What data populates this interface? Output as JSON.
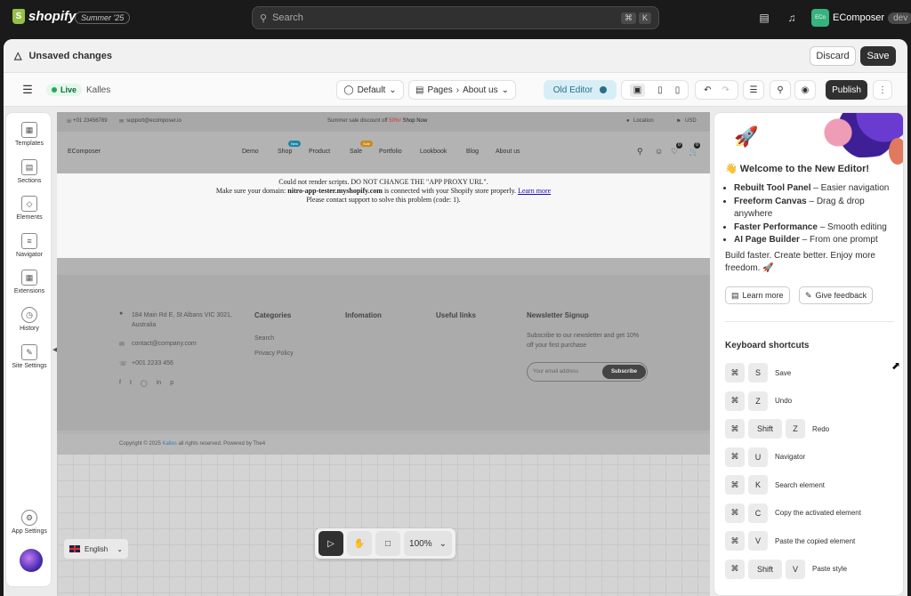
{
  "topbar": {
    "logo": "shopify",
    "season": "Summer '25",
    "search_placeholder": "Search",
    "kbd1": "⌘",
    "kbd2": "K",
    "account_name": "EComposer",
    "account_avatar": "ECo",
    "account_badge": "dev"
  },
  "unsaved": {
    "title": "Unsaved changes",
    "discard": "Discard",
    "save": "Save"
  },
  "toolbar": {
    "status": "Live",
    "theme": "Kalles",
    "template": "Default",
    "pages_label": "Pages",
    "page": "About us",
    "old_editor": "Old Editor",
    "publish": "Publish"
  },
  "leftbar": [
    {
      "label": "Templates",
      "icon": "templates-icon"
    },
    {
      "label": "Sections",
      "icon": "sections-icon"
    },
    {
      "label": "Elements",
      "icon": "elements-icon"
    },
    {
      "label": "Navigator",
      "icon": "navigator-icon"
    },
    {
      "label": "Extensions",
      "icon": "extensions-icon"
    },
    {
      "label": "History",
      "icon": "history-icon"
    },
    {
      "label": "Site Settings",
      "icon": "site-settings-icon"
    }
  ],
  "app_settings": "App Settings",
  "site": {
    "phone": "+01 23456789",
    "email": "support@ecomposer.io",
    "announce_prefix": "Summer sale discount off",
    "announce_pct": "50%!",
    "announce_link": "Shop Now",
    "location": "Location",
    "currency": "USD",
    "brand": "EComposer",
    "nav": [
      {
        "label": "Demo",
        "badge": ""
      },
      {
        "label": "Shop",
        "badge": "New"
      },
      {
        "label": "Product",
        "badge": ""
      },
      {
        "label": "Sale",
        "badge": "Sale"
      },
      {
        "label": "Portfolio",
        "badge": ""
      },
      {
        "label": "Lookbook",
        "badge": ""
      },
      {
        "label": "Blog",
        "badge": ""
      },
      {
        "label": "About us",
        "badge": ""
      }
    ],
    "wish_count": "0",
    "cart_count": "0",
    "error": {
      "line1": "Could not render scripts. DO NOT CHANGE THE \"APP PROXY URL\".",
      "line2_pre": "Make sure your domain:",
      "domain": "nitro-app-tester.myshopify.com",
      "line2_post": "is connected with your Shopify store properly.",
      "learn": "Learn more",
      "line3": "Please contact support to solve this problem (code: 1)."
    },
    "footer": {
      "address": "184 Main Rd E, St Albans VIC 3021, Australia",
      "contact": "contact@company.com",
      "phone": "+001 2233 456",
      "col1_title": "Categories",
      "col1_items": [
        "Search",
        "Privacy Policy"
      ],
      "col2_title": "Infomation",
      "col3_title": "Useful links",
      "col4_title": "Newsletter Signup",
      "newsletter_text": "Subscribe to our newsletter and get 10% off your first purchase",
      "email_placeholder": "Your email address",
      "subscribe": "Subscribe"
    },
    "copyright_pre": "Copyright © 2025",
    "copyright_brand": "Kalles",
    "copyright_post": "all rights reserved. Powered by The4"
  },
  "float_tools": {
    "zoom": "100%"
  },
  "language": "English",
  "right": {
    "welcome": "Welcome to the New Editor!",
    "bullets": [
      {
        "b": "Rebuilt Tool Panel",
        "t": " – Easier navigation"
      },
      {
        "b": "Freeform Canvas",
        "t": " – Drag & drop anywhere"
      },
      {
        "b": "Faster Performance",
        "t": " – Smooth editing"
      },
      {
        "b": "AI Page Builder",
        "t": " – From one prompt"
      }
    ],
    "tagline": "Build faster. Create better. Enjoy more freedom. 🚀",
    "learn_more": "Learn more",
    "feedback": "Give feedback",
    "shortcuts_title": "Keyboard shortcuts",
    "shortcuts": [
      {
        "keys": [
          "⌘",
          "S"
        ],
        "label": "Save"
      },
      {
        "keys": [
          "⌘",
          "Z"
        ],
        "label": "Undo"
      },
      {
        "keys": [
          "⌘",
          "Shift",
          "Z"
        ],
        "label": "Redo"
      },
      {
        "keys": [
          "⌘",
          "U"
        ],
        "label": "Navigator"
      },
      {
        "keys": [
          "⌘",
          "K"
        ],
        "label": "Search element"
      },
      {
        "keys": [
          "⌘",
          "C"
        ],
        "label": "Copy the activated element"
      },
      {
        "keys": [
          "⌘",
          "V"
        ],
        "label": "Paste the copied element"
      },
      {
        "keys": [
          "⌘",
          "Shift",
          "V"
        ],
        "label": "Paste style"
      }
    ]
  }
}
